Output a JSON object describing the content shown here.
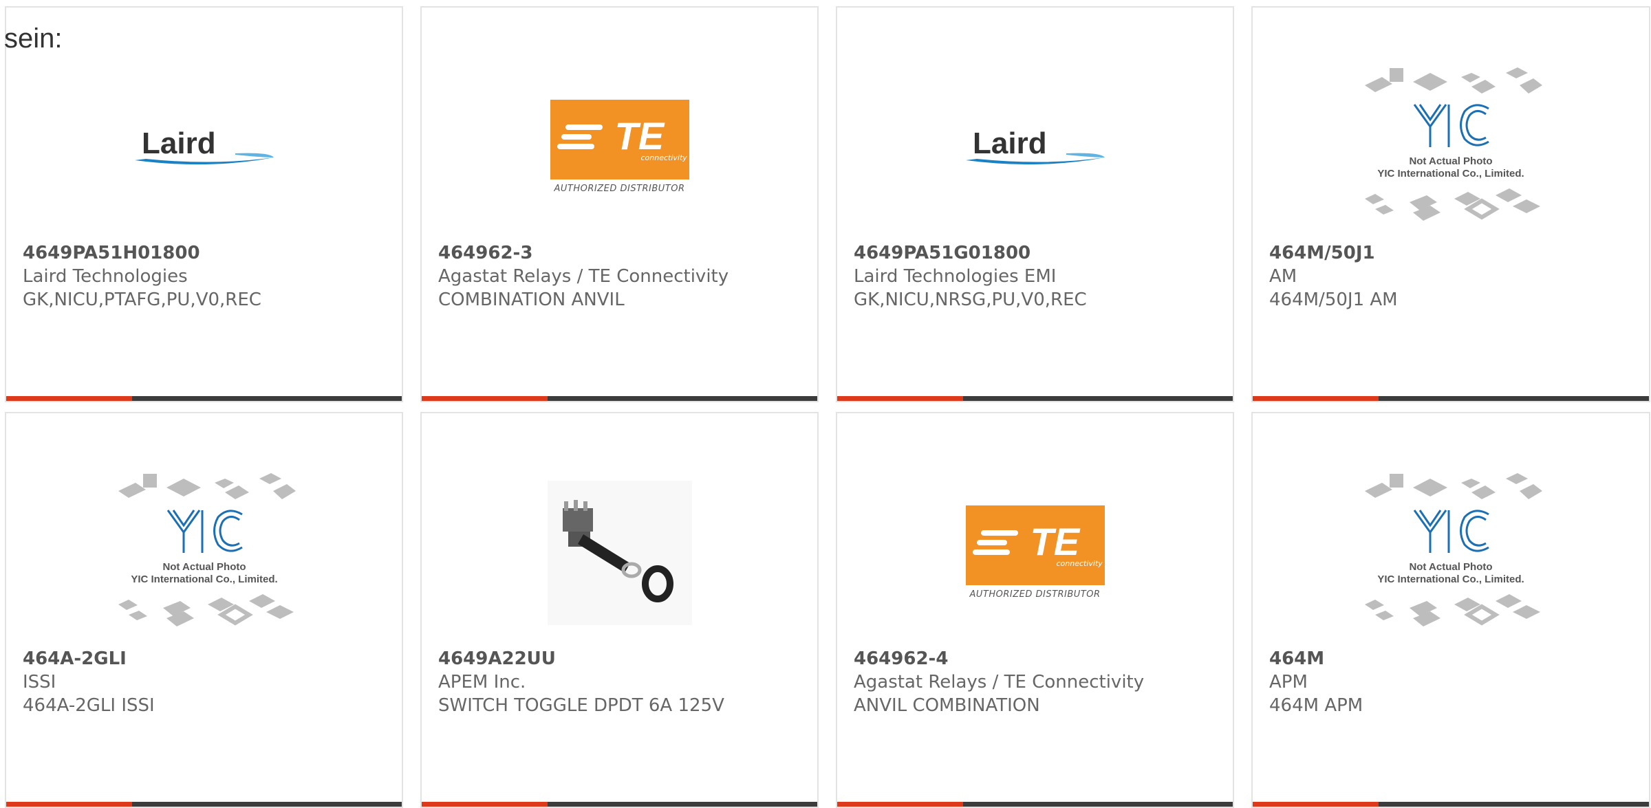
{
  "intro_text": "sein:",
  "logos": {
    "laird": "Laird",
    "te_word": "TE",
    "te_sub": "connectivity",
    "te_dist": "AUTHORIZED DISTRIBUTOR",
    "yic_line1": "Not Actual Photo",
    "yic_line2": "YIC International Co., Limited."
  },
  "colors": {
    "accent": "#dd3a1c",
    "bar": "#3c3c3c",
    "te_orange": "#f39224",
    "laird_blue": "#1a82c4"
  },
  "products": [
    {
      "part": "4649PA51H01800",
      "maker": "Laird Technologies",
      "desc": "GK,NICU,PTAFG,PU,V0,REC",
      "image": "laird-logo"
    },
    {
      "part": "464962-3",
      "maker": "Agastat Relays / TE Connectivity",
      "desc": "COMBINATION ANVIL",
      "image": "te-logo"
    },
    {
      "part": "4649PA51G01800",
      "maker": "Laird Technologies EMI",
      "desc": "GK,NICU,NRSG,PU,V0,REC",
      "image": "laird-logo"
    },
    {
      "part": "464M/50J1",
      "maker": "AM",
      "desc": "464M/50J1 AM",
      "image": "yic-placeholder"
    },
    {
      "part": "464A-2GLI",
      "maker": "ISSI",
      "desc": "464A-2GLI ISSI",
      "image": "yic-placeholder"
    },
    {
      "part": "4649A22UU",
      "maker": "APEM Inc.",
      "desc": "SWITCH TOGGLE DPDT 6A 125V",
      "image": "toggle-switch-photo"
    },
    {
      "part": "464962-4",
      "maker": "Agastat Relays / TE Connectivity",
      "desc": "ANVIL COMBINATION",
      "image": "te-logo"
    },
    {
      "part": "464M",
      "maker": "APM",
      "desc": "464M APM",
      "image": "yic-placeholder"
    }
  ]
}
